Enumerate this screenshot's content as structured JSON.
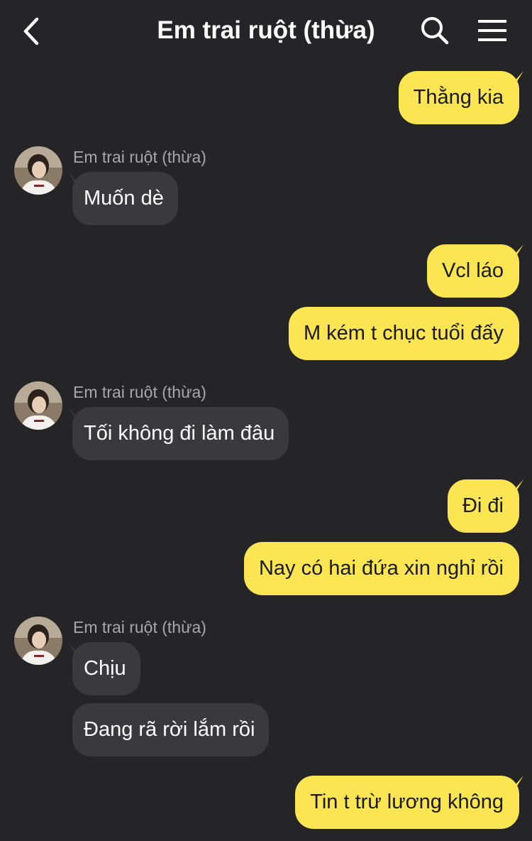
{
  "header": {
    "title": "Em trai ruột (thừa)",
    "back_icon": "chevron-left-icon",
    "search_icon": "search-icon",
    "menu_icon": "hamburger-menu-icon"
  },
  "colors": {
    "background": "#252527",
    "outgoing_bubble": "#fbe553",
    "incoming_bubble": "#3a3a3c"
  },
  "messages": [
    {
      "side": "out",
      "text": "Thằng kia"
    },
    {
      "side": "in",
      "sender": "Em trai ruột (thừa)",
      "text": "Muốn dè"
    },
    {
      "side": "out",
      "text": "Vcl láo"
    },
    {
      "side": "out",
      "text": "M kém t chục tuổi đấy"
    },
    {
      "side": "in",
      "sender": "Em trai ruột (thừa)",
      "text": "Tối không đi làm đâu"
    },
    {
      "side": "out",
      "text": "Đi đi"
    },
    {
      "side": "out",
      "text": "Nay có hai đứa xin nghỉ rồi"
    },
    {
      "side": "in",
      "sender": "Em trai ruột (thừa)",
      "text": "Chịu"
    },
    {
      "side": "in",
      "text": "Đang rã rời lắm rồi"
    },
    {
      "side": "out",
      "text": "Tin t trừ lương không"
    }
  ]
}
